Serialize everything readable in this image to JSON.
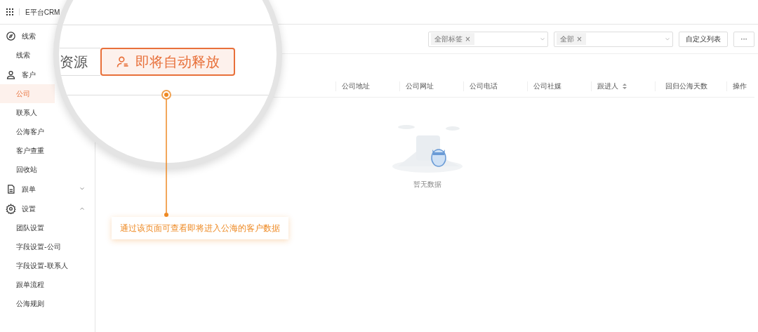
{
  "topbar": {
    "app_name": "E平台CRM"
  },
  "sidebar": {
    "groups": [
      {
        "label": "线索",
        "children": [
          {
            "label": "线索",
            "selected": false
          }
        ]
      },
      {
        "label": "客户",
        "children": [
          {
            "label": "公司",
            "selected": true
          },
          {
            "label": "联系人",
            "selected": false
          },
          {
            "label": "公海客户",
            "selected": false
          },
          {
            "label": "客户查重",
            "selected": false
          },
          {
            "label": "回收站",
            "selected": false
          }
        ]
      },
      {
        "label": "跟单",
        "expanded": false
      },
      {
        "label": "设置",
        "expanded": true,
        "children": [
          {
            "label": "团队设置",
            "selected": false
          },
          {
            "label": "字段设置-公司",
            "selected": false
          },
          {
            "label": "字段设置-联系人",
            "selected": false
          },
          {
            "label": "跟单流程",
            "selected": false
          },
          {
            "label": "公海规则",
            "selected": false
          }
        ]
      }
    ]
  },
  "filters": [
    {
      "chip": "全部标签 ×"
    },
    {
      "chip": "全部 ×"
    }
  ],
  "toolbar_buttons": [
    "自定义列表",
    "···"
  ],
  "table": {
    "columns": [
      {
        "label": "公司地址",
        "sortable": false
      },
      {
        "label": "公司网址",
        "sortable": false
      },
      {
        "label": "公司电话",
        "sortable": false
      },
      {
        "label": "公司社媒",
        "sortable": false
      },
      {
        "label": "跟进人",
        "sortable": true
      },
      {
        "label": "回归公海天数",
        "sortable": false
      },
      {
        "label": "操作",
        "sortable": false
      }
    ],
    "empty_text": "暂无数据"
  },
  "magnifier": {
    "tabs": [
      {
        "label": "资源",
        "selected": false
      },
      {
        "label": "即将自动释放",
        "selected": true
      }
    ]
  },
  "callout": "通过该页面可查看即将进入公海的客户数据"
}
